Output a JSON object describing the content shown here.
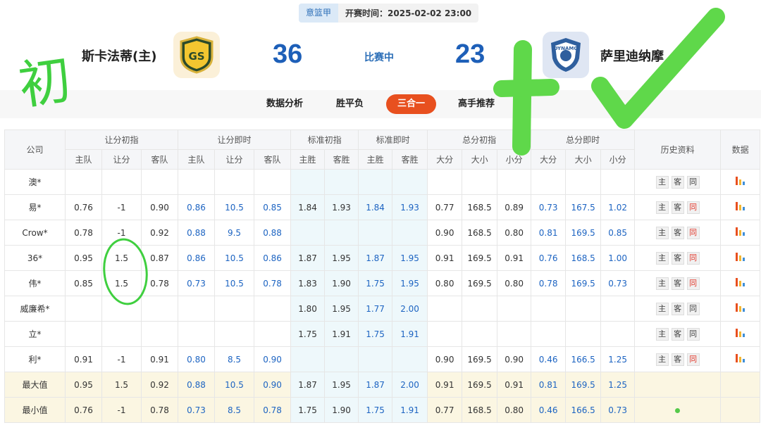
{
  "match": {
    "league": "意篮甲",
    "start_time": "开赛时间：2025-02-02 23:00",
    "home_team": "斯卡法蒂(主)",
    "away_team": "萨里迪纳摩",
    "home_score": "36",
    "away_score": "23",
    "status": "比赛中",
    "home_logo_text": "GS",
    "away_logo_text": "DYNAMO"
  },
  "tabs": [
    "数据分析",
    "胜平负",
    "三合一",
    "高手推荐"
  ],
  "active_tab": "三合一",
  "table": {
    "group_headers": [
      "公司",
      "让分初指",
      "让分即时",
      "标准初指",
      "标准即时",
      "总分初指",
      "总分即时",
      "历史资料",
      "数据"
    ],
    "sub_headers": [
      "主队",
      "让分",
      "客队",
      "主队",
      "让分",
      "客队",
      "主胜",
      "客胜",
      "主胜",
      "客胜",
      "大分",
      "大小",
      "小分",
      "大分",
      "大小",
      "小分"
    ],
    "history_labels": [
      "主",
      "客",
      "同"
    ],
    "rows": [
      {
        "company": "澳*",
        "hcp_init": [
          "",
          "",
          ""
        ],
        "hcp_live": [
          "",
          "",
          ""
        ],
        "std_init": [
          "",
          ""
        ],
        "std_live": [
          "",
          ""
        ],
        "tot_init": [
          "",
          "",
          ""
        ],
        "tot_live": [
          "",
          "",
          ""
        ],
        "same_red": false
      },
      {
        "company": "易*",
        "hcp_init": [
          "0.76",
          "-1",
          "0.90"
        ],
        "hcp_live": [
          "0.86",
          "10.5",
          "0.85"
        ],
        "std_init": [
          "1.84",
          "1.93"
        ],
        "std_live": [
          "1.84",
          "1.93"
        ],
        "tot_init": [
          "0.77",
          "168.5",
          "0.89"
        ],
        "tot_live": [
          "0.73",
          "167.5",
          "1.02"
        ],
        "same_red": true
      },
      {
        "company": "Crow*",
        "hcp_init": [
          "0.78",
          "-1",
          "0.92"
        ],
        "hcp_live": [
          "0.88",
          "9.5",
          "0.88"
        ],
        "std_init": [
          "",
          ""
        ],
        "std_live": [
          "",
          ""
        ],
        "tot_init": [
          "0.90",
          "168.5",
          "0.80"
        ],
        "tot_live": [
          "0.81",
          "169.5",
          "0.85"
        ],
        "same_red": true
      },
      {
        "company": "36*",
        "hcp_init": [
          "0.95",
          "1.5",
          "0.87"
        ],
        "hcp_live": [
          "0.86",
          "10.5",
          "0.86"
        ],
        "std_init": [
          "1.87",
          "1.95"
        ],
        "std_live": [
          "1.87",
          "1.95"
        ],
        "tot_init": [
          "0.91",
          "169.5",
          "0.91"
        ],
        "tot_live": [
          "0.76",
          "168.5",
          "1.00"
        ],
        "same_red": true
      },
      {
        "company": "伟*",
        "hcp_init": [
          "0.85",
          "1.5",
          "0.78"
        ],
        "hcp_live": [
          "0.73",
          "10.5",
          "0.78"
        ],
        "std_init": [
          "1.83",
          "1.90"
        ],
        "std_live": [
          "1.75",
          "1.95"
        ],
        "tot_init": [
          "0.80",
          "169.5",
          "0.80"
        ],
        "tot_live": [
          "0.78",
          "169.5",
          "0.73"
        ],
        "same_red": true
      },
      {
        "company": "威廉希*",
        "hcp_init": [
          "",
          "",
          ""
        ],
        "hcp_live": [
          "",
          "",
          ""
        ],
        "std_init": [
          "1.80",
          "1.95"
        ],
        "std_live": [
          "1.77",
          "2.00"
        ],
        "tot_init": [
          "",
          "",
          ""
        ],
        "tot_live": [
          "",
          "",
          ""
        ],
        "same_red": false
      },
      {
        "company": "立*",
        "hcp_init": [
          "",
          "",
          ""
        ],
        "hcp_live": [
          "",
          "",
          ""
        ],
        "std_init": [
          "1.75",
          "1.91"
        ],
        "std_live": [
          "1.75",
          "1.91"
        ],
        "tot_init": [
          "",
          "",
          ""
        ],
        "tot_live": [
          "",
          "",
          ""
        ],
        "same_red": false
      },
      {
        "company": "利*",
        "hcp_init": [
          "0.91",
          "-1",
          "0.91"
        ],
        "hcp_live": [
          "0.80",
          "8.5",
          "0.90"
        ],
        "std_init": [
          "",
          ""
        ],
        "std_live": [
          "",
          ""
        ],
        "tot_init": [
          "0.90",
          "169.5",
          "0.90"
        ],
        "tot_live": [
          "0.46",
          "166.5",
          "1.25"
        ],
        "same_red": true
      }
    ],
    "summary": [
      {
        "company": "最大值",
        "hcp_init": [
          "0.95",
          "1.5",
          "0.92"
        ],
        "hcp_live": [
          "0.88",
          "10.5",
          "0.90"
        ],
        "std_init": [
          "1.87",
          "1.95"
        ],
        "std_live": [
          "1.87",
          "2.00"
        ],
        "tot_init": [
          "0.91",
          "169.5",
          "0.91"
        ],
        "tot_live": [
          "0.81",
          "169.5",
          "1.25"
        ]
      },
      {
        "company": "最小值",
        "hcp_init": [
          "0.76",
          "-1",
          "0.78"
        ],
        "hcp_live": [
          "0.73",
          "8.5",
          "0.78"
        ],
        "std_init": [
          "1.75",
          "1.90"
        ],
        "std_live": [
          "1.75",
          "1.91"
        ],
        "tot_init": [
          "0.77",
          "168.5",
          "0.80"
        ],
        "tot_live": [
          "0.46",
          "166.5",
          "0.73"
        ]
      }
    ]
  },
  "annotations": {
    "handwritten_char": "初"
  },
  "colors": {
    "accent": "#e8501f",
    "score_blue": "#1d5fb8",
    "live_value_blue": "#1d64c2",
    "highlight_green": "#3fcf3f"
  }
}
